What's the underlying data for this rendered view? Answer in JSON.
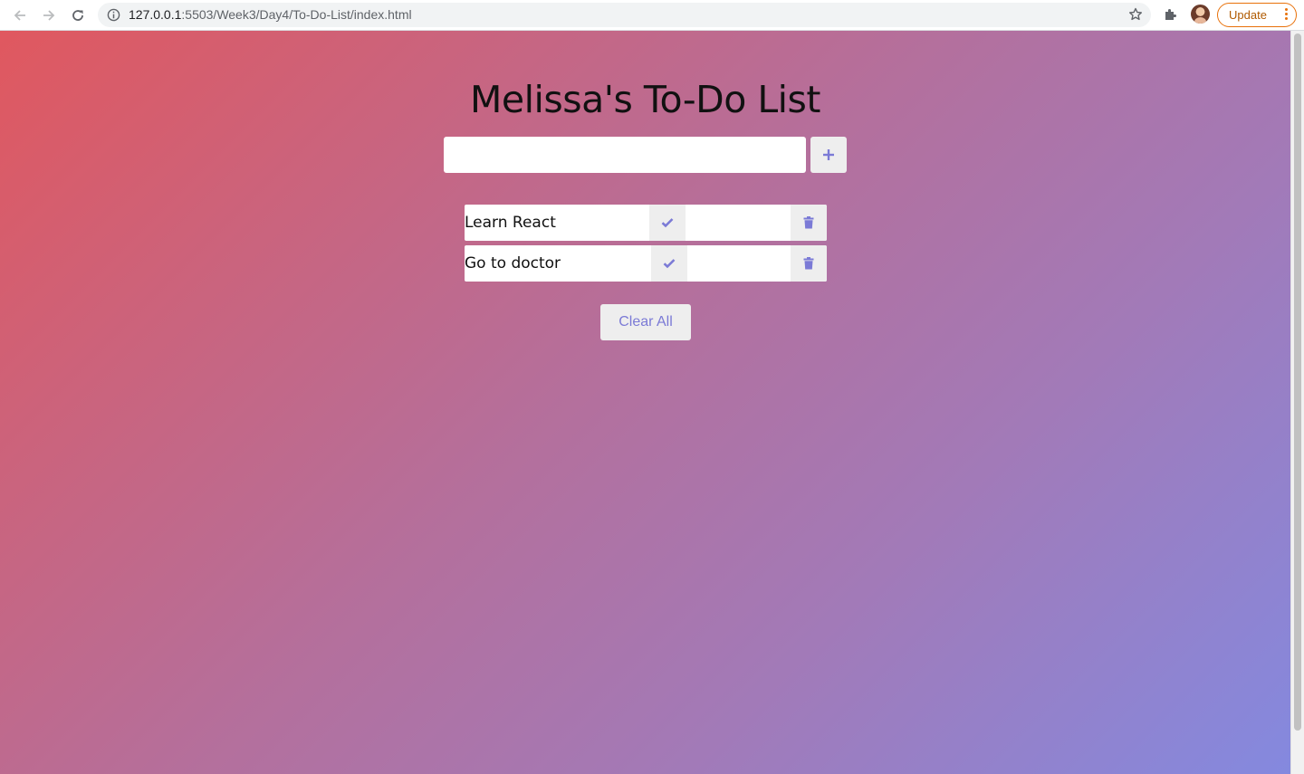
{
  "browser": {
    "url_host": "127.0.0.1",
    "url_path": ":5503/Week3/Day4/To-Do-List/index.html",
    "update_label": "Update",
    "icons": {
      "back": "arrow-left-icon",
      "forward": "arrow-right-icon",
      "reload": "reload-icon",
      "info": "info-icon",
      "bookmark": "star-icon",
      "extensions": "puzzle-icon",
      "menu": "kebab-menu-icon"
    }
  },
  "app": {
    "title": "Melissa's To-Do List",
    "new_todo": {
      "value": "",
      "placeholder": ""
    },
    "add_label": "+",
    "todos": [
      {
        "text": "Learn React"
      },
      {
        "text": "Go to doctor"
      }
    ],
    "clear_label": "Clear All",
    "colors": {
      "gradient_start": "#e0585f",
      "gradient_end": "#8489df",
      "accent": "#7b7ad6",
      "button_bg": "#eeeeee"
    }
  }
}
